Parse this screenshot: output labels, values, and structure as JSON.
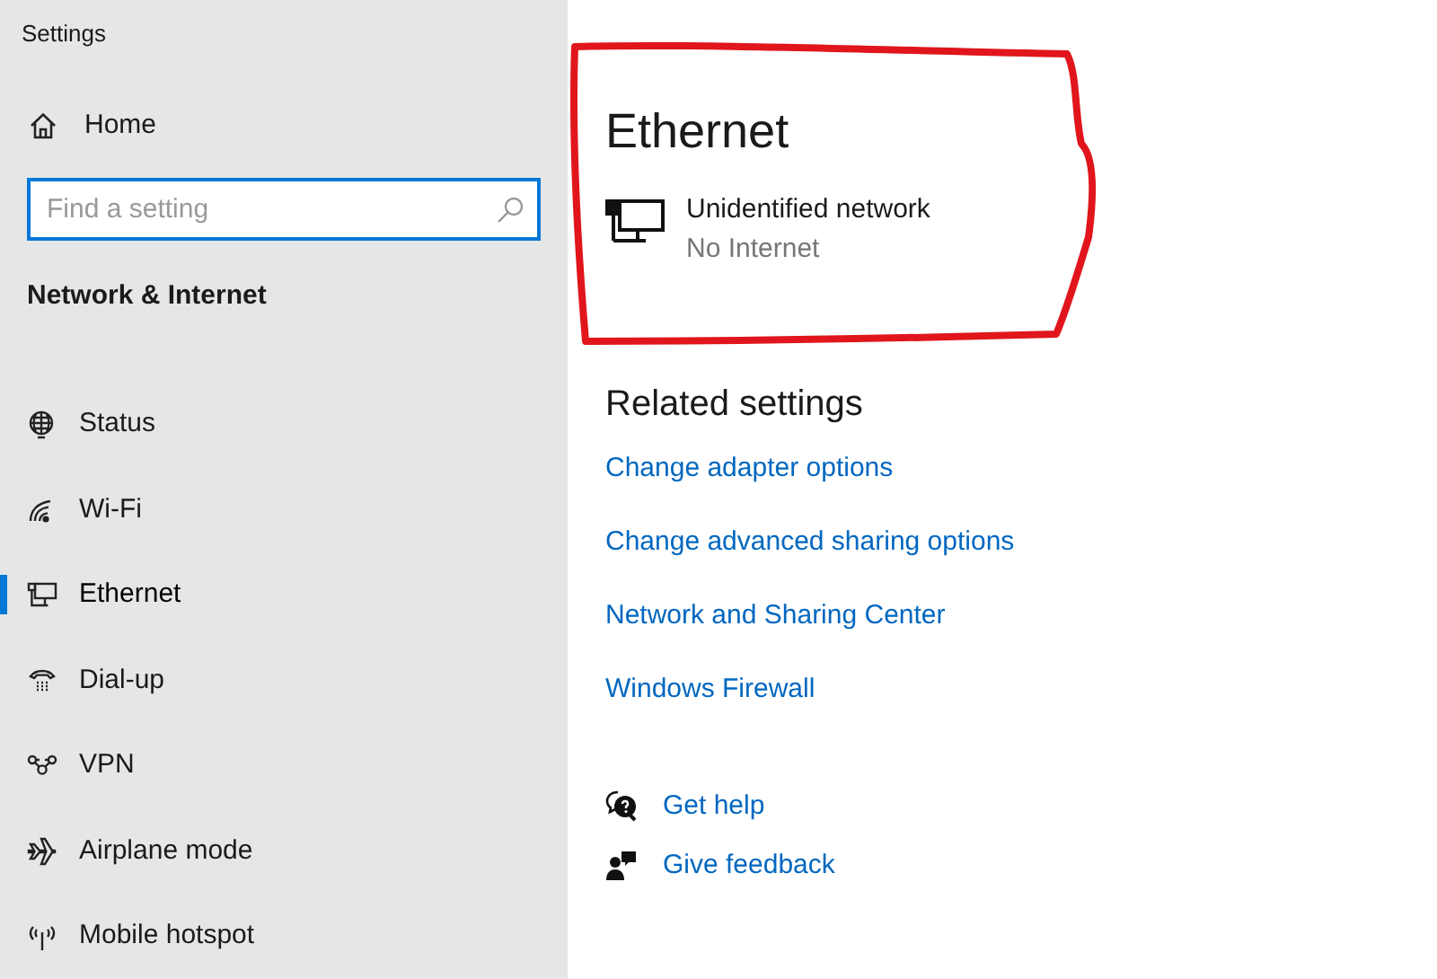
{
  "window": {
    "title": "Settings"
  },
  "sidebar": {
    "home": "Home",
    "search": {
      "placeholder": "Find a setting"
    },
    "section": "Network & Internet",
    "items": [
      {
        "label": "Status",
        "selected": false
      },
      {
        "label": "Wi-Fi",
        "selected": false
      },
      {
        "label": "Ethernet",
        "selected": true
      },
      {
        "label": "Dial-up",
        "selected": false
      },
      {
        "label": "VPN",
        "selected": false
      },
      {
        "label": "Airplane mode",
        "selected": false
      },
      {
        "label": "Mobile hotspot",
        "selected": false
      }
    ]
  },
  "main": {
    "title": "Ethernet",
    "network": {
      "name": "Unidentified network",
      "status": "No Internet"
    },
    "related_title": "Related settings",
    "links": [
      "Change adapter options",
      "Change advanced sharing options",
      "Network and Sharing Center",
      "Windows Firewall"
    ],
    "help": [
      "Get help",
      "Give feedback"
    ]
  }
}
